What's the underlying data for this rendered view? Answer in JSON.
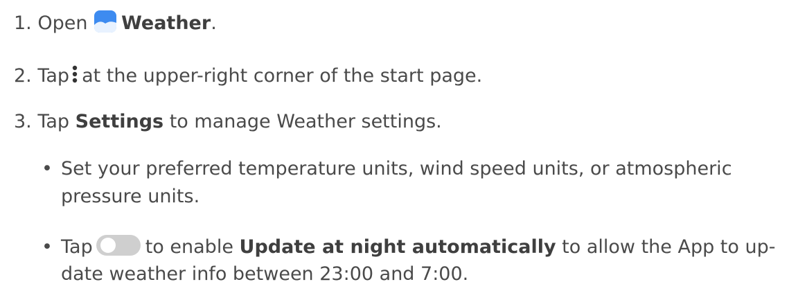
{
  "steps": [
    {
      "number": "1.",
      "text_before": "Open",
      "icon": "weather-app-icon",
      "bold": "Weather",
      "text_after": "."
    },
    {
      "number": "2.",
      "text_before": "Tap",
      "icon": "more-vertical-icon",
      "text_after": "at the upper-right corner of the start page."
    },
    {
      "number": "3.",
      "text_before": "Tap",
      "bold": "Settings",
      "text_after": "to manage Weather settings."
    }
  ],
  "bullets": [
    {
      "line1": "Set your preferred temperature units, wind speed units, or atmospheric",
      "line2": "pressure units."
    },
    {
      "text_before": "Tap",
      "icon": "toggle-switch-icon",
      "text_mid": "to enable",
      "bold": "Update at night automatically",
      "text_after": "to allow the App to up-",
      "line2": "date weather info between 23:00 and 7:00."
    }
  ],
  "colors": {
    "text": "#4a4a4a",
    "weather_icon_blue": "#3d8bf0",
    "toggle_gray": "#cfcfcf"
  }
}
